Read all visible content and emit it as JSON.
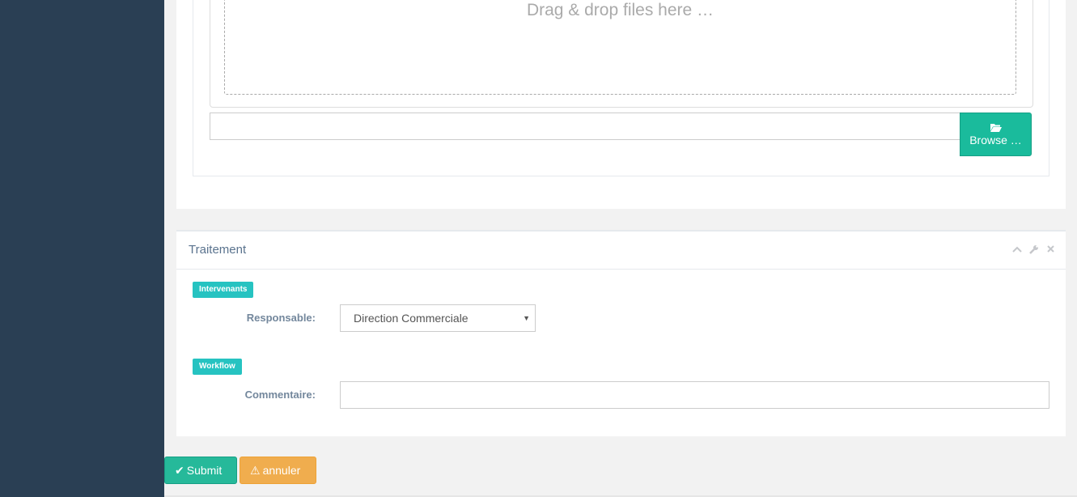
{
  "upload": {
    "drop_text": "Drag & drop files here …",
    "browse_label": "Browse …"
  },
  "panel": {
    "title": "Traitement",
    "tools": [
      "chevron-up-icon",
      "wrench-icon",
      "close-icon"
    ]
  },
  "form": {
    "section_intervenants": "Intervenants",
    "responsable_label": "Responsable:",
    "responsable_value": "Direction Commerciale",
    "section_workflow": "Workflow",
    "commentaire_label": "Commentaire:",
    "commentaire_value": ""
  },
  "actions": {
    "submit_label": "Submit",
    "cancel_label": "annuler"
  },
  "colors": {
    "sidebar": "#2a3f54",
    "primary": "#1abb9c",
    "warning": "#f0ad4e",
    "badge": "#26c3c1"
  }
}
